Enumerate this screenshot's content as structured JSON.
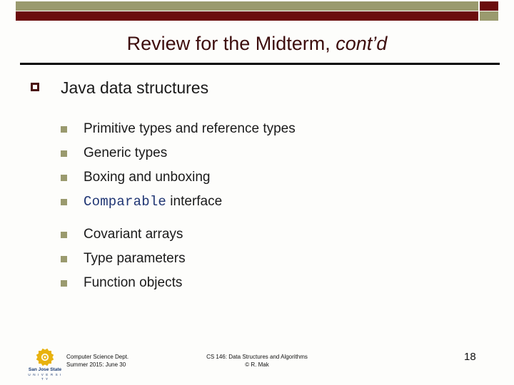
{
  "theme": {
    "banner_olive": "#9a9a6e",
    "banner_darkred": "#6b0d0d",
    "title_color": "#3d0d0d",
    "bullet1_color": "#4a1111",
    "bullet2_color": "#9a9a6e",
    "code_color": "#1f3573",
    "text_color": "#1a1a1a",
    "logo_gold": "#e8b20e",
    "logo_blue": "#1a3a73"
  },
  "banner": {
    "top_bar": "olive-bar",
    "top_cap": "darkred-cap",
    "bottom_bar": "darkred-bar",
    "bottom_cap": "olive-cap"
  },
  "title": {
    "main": "Review for the Midterm, ",
    "emphasis": "cont’d"
  },
  "content": {
    "topic": {
      "label": "Java data structures",
      "marker": "hollow-square-bullet"
    },
    "items": [
      {
        "label": "Primitive types and reference types",
        "marker": "filled-square-bullet",
        "code": ""
      },
      {
        "label": "Generic types",
        "marker": "filled-square-bullet",
        "code": ""
      },
      {
        "label": "Boxing and unboxing",
        "marker": "filled-square-bullet",
        "code": ""
      },
      {
        "label": " interface",
        "marker": "filled-square-bullet",
        "code": "Comparable"
      },
      {
        "label": "Covariant arrays",
        "marker": "filled-square-bullet",
        "code": ""
      },
      {
        "label": "Type parameters",
        "marker": "filled-square-bullet",
        "code": ""
      },
      {
        "label": "Function objects",
        "marker": "filled-square-bullet",
        "code": ""
      }
    ]
  },
  "footer": {
    "logo": {
      "name": "San Jose State",
      "subtitle": "U N I V E R S I T Y",
      "icon": "sjsu-rosette-logo"
    },
    "left_line1": "Computer Science Dept.",
    "left_line2": "Summer 2015: June 30",
    "center_line1": "CS 146: Data Structures and Algorithms",
    "center_line2": "© R. Mak",
    "page_number": "18"
  }
}
